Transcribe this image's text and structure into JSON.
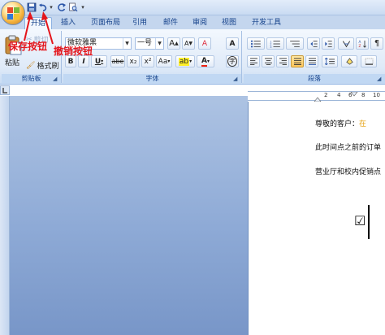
{
  "quick_access": {
    "undo_dropdown": "▾",
    "customize": "▾"
  },
  "tabs": [
    {
      "label": "开始"
    },
    {
      "label": "插入"
    },
    {
      "label": "页面布局"
    },
    {
      "label": "引用"
    },
    {
      "label": "邮件"
    },
    {
      "label": "审阅"
    },
    {
      "label": "视图"
    },
    {
      "label": "开发工具"
    }
  ],
  "ribbon": {
    "clipboard": {
      "label": "剪贴板",
      "paste": "粘贴",
      "cut": "剪切",
      "format_painter": "格式刷"
    },
    "font": {
      "label": "字体",
      "font_name": "微软雅黑",
      "font_size": "一号",
      "grow": "A",
      "shrink": "A",
      "clear": "A",
      "bold": "B",
      "italic": "I",
      "underline": "U",
      "strike": "abe",
      "subscript": "x₂",
      "superscript": "x²",
      "case": "Aa",
      "highlight": "ab",
      "font_color": "A",
      "char_border": "A",
      "enclose": "字"
    },
    "paragraph": {
      "label": "段落"
    }
  },
  "ruler": {
    "numbers": [
      "2",
      "4",
      "6",
      "8",
      "10"
    ]
  },
  "document": {
    "line1_prefix": "尊敬的客户：",
    "line1_highlight": "在",
    "line2": "此时间点之前的订单",
    "line3": "营业厅和校内促销点",
    "checkbox_char": "☑"
  },
  "annotations": {
    "save_label": "保存按钮",
    "undo_label": "撤销按钮"
  },
  "colors": {
    "annotation": "#e4151b",
    "highlight_text": "#e5a00d"
  }
}
